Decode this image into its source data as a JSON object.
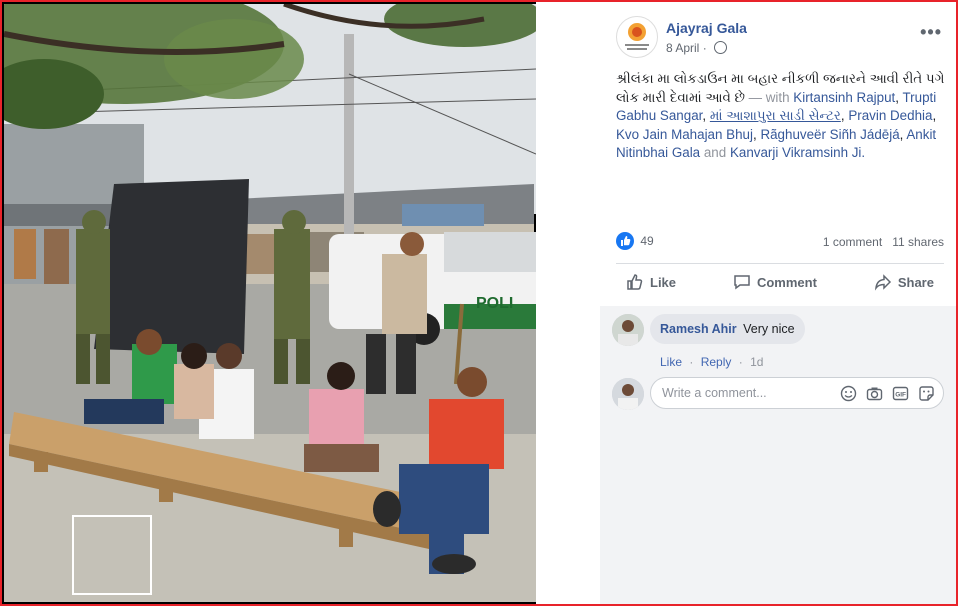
{
  "post": {
    "author": "Ajayraj Gala",
    "date": "8 April",
    "privacy_icon": "globe-icon",
    "menu_icon": "more-options-icon",
    "message": "શ્રીલંકા મા લોકડાઉન મા બહાર નીકળી જનારને આવી રીતે પગે લોક મારી દેવામાં આવે છે",
    "with_label": "— with",
    "tags": [
      "Kirtansinh Rajput",
      "Trupti Gabhu Sangar",
      "માં આશાપુરા સાડી સેન્ટર",
      "Pravin Dedhia",
      "Kvo Jain Mahajan Bhuj",
      "Rãghuveër Siñh Jádējá",
      "Ankit Nitinbhai Gala"
    ],
    "and_label": "and",
    "last_tag": "Kanvarji Vikramsinh Ji.",
    "sep1": ",",
    "sep2": ",",
    "sep3": ",",
    "sep4": ",",
    "sep5": ",",
    "sep6": ",",
    "reactions_count": "49",
    "comments_count": "1 comment",
    "shares_count": "11 shares"
  },
  "actions": {
    "like": "Like",
    "comment": "Comment",
    "share": "Share"
  },
  "comment": {
    "author": "Ramesh Ahir",
    "text": "Very nice",
    "like": "Like",
    "reply": "Reply",
    "sep": "·",
    "time": "1d"
  },
  "composer": {
    "placeholder": "Write a comment...",
    "icons": [
      "emoji-icon",
      "camera-icon",
      "gif-icon",
      "sticker-icon"
    ]
  },
  "photo": {
    "vehicle_text": "POLI"
  },
  "colors": {
    "link": "#365899",
    "border": "#e8232a",
    "like_blue": "#1877f2"
  }
}
